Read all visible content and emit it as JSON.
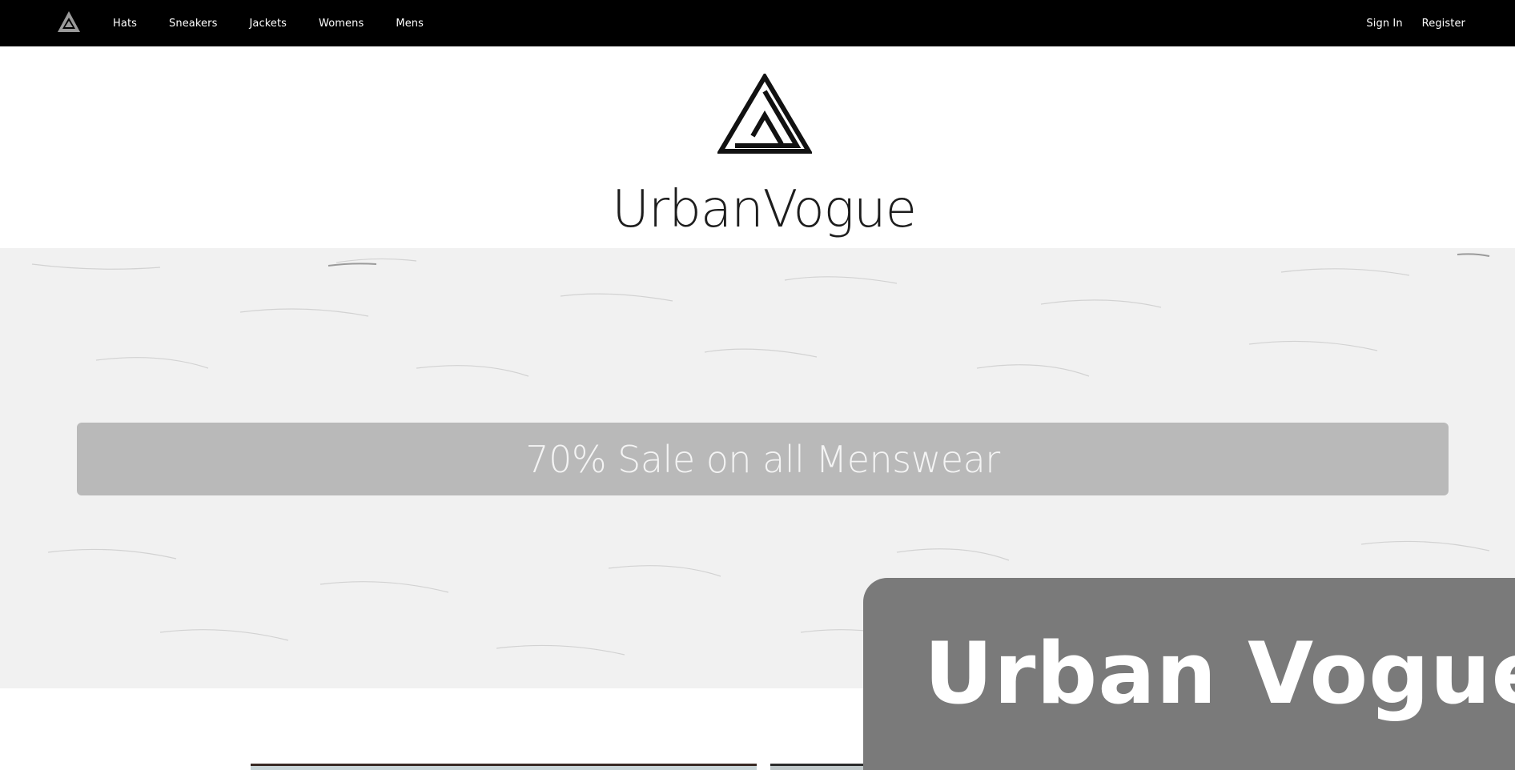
{
  "nav": {
    "links": [
      "Hats",
      "Sneakers",
      "Jackets",
      "Womens",
      "Mens"
    ],
    "sign_in": "Sign In",
    "register": "Register",
    "logo_icon": "triangle-logo-icon"
  },
  "brand": {
    "name": "UrbanVogue",
    "logo_icon": "triangle-logo-icon"
  },
  "hero": {
    "sale_text": "70% Sale on all Menswear"
  },
  "overlay": {
    "title": "Urban Vogue"
  },
  "colors": {
    "nav_bg": "#000000",
    "hero_bg": "#f1f1f1",
    "banner_bg": "#969696",
    "overlay_bg": "#7a7a7a"
  }
}
